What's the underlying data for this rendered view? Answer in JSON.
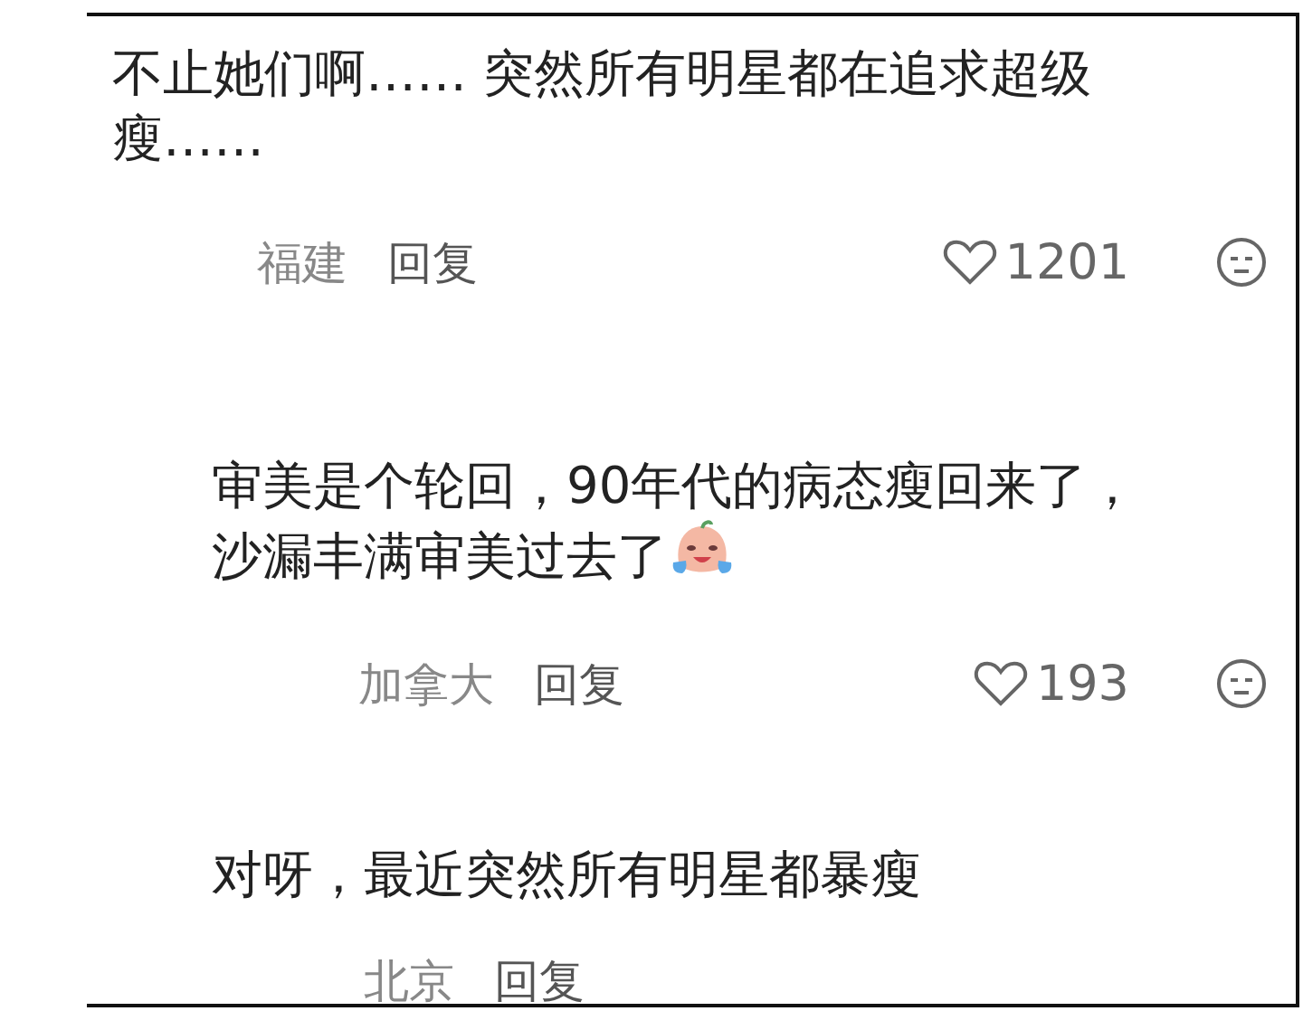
{
  "comments": [
    {
      "text": "不止她们啊…… 突然所有明星都在追求超级瘦……",
      "location": "福建",
      "reply": "回复",
      "likes": "1201",
      "reply_level": false,
      "emoji": false
    },
    {
      "text": "审美是个轮回，90年代的病态瘦回来了，沙漏丰满审美过去了",
      "location": "加拿大",
      "reply": "回复",
      "likes": "193",
      "reply_level": true,
      "emoji": true
    },
    {
      "text": "对呀，最近突然所有明星都暴瘦",
      "location": "北京",
      "reply": "回复",
      "reply_level": true,
      "emoji": false
    }
  ]
}
